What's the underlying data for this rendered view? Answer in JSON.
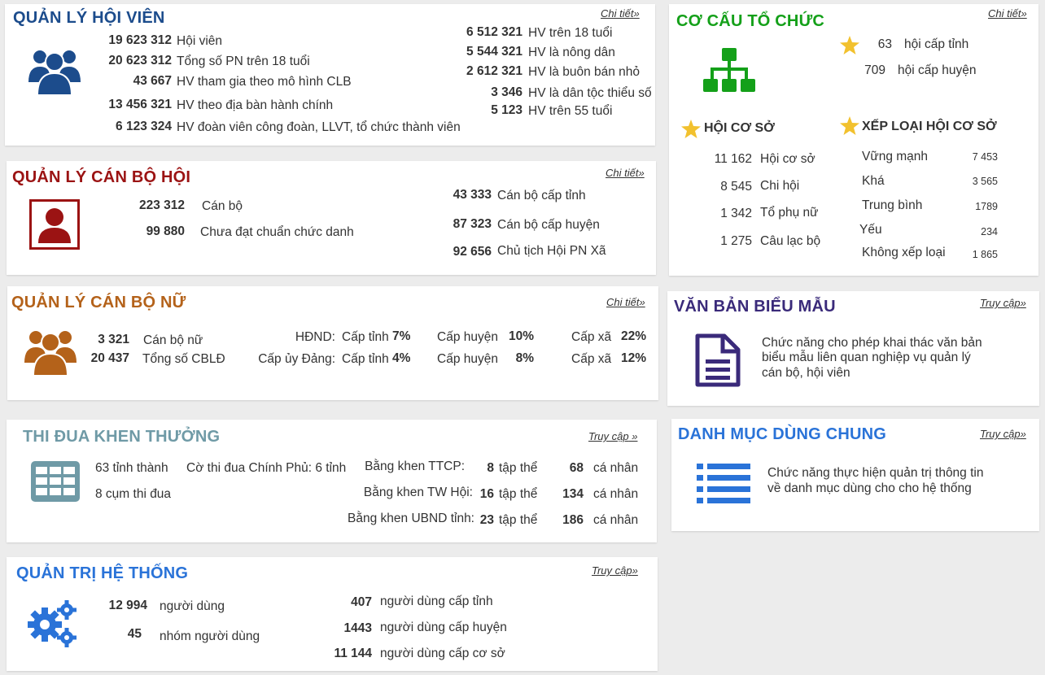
{
  "hoi_vien": {
    "title": "QUẢN LÝ HỘI VIÊN",
    "link": "Chi tiết",
    "left": [
      {
        "value": "19 623 312",
        "label": "Hội viên"
      },
      {
        "value": "20 623 312",
        "label": "Tổng số PN trên 18 tuổi"
      },
      {
        "value": "43 667",
        "label": "HV tham gia theo mô hình CLB"
      },
      {
        "value": "13 456 321",
        "label": "HV theo địa bàn hành chính"
      },
      {
        "value": "6 123 324",
        "label": "HV đoàn viên công đoàn, LLVT, tổ chức thành viên"
      }
    ],
    "right": [
      {
        "value": "6 512 321",
        "label": "HV trên 18 tuổi"
      },
      {
        "value": "5 544 321",
        "label": "HV là nông dân"
      },
      {
        "value": "2 612 321",
        "label": "HV là buôn bán nhỏ"
      },
      {
        "value": "3 346",
        "label": "HV là dân tộc thiểu số"
      },
      {
        "value": "5 123",
        "label": "HV trên 55 tuổi"
      }
    ]
  },
  "can_bo_hoi": {
    "title": "QUẢN LÝ CÁN BỘ HỘI",
    "link": "Chi tiết",
    "left": [
      {
        "value": "223 312",
        "label": "Cán bộ"
      },
      {
        "value": "99 880",
        "label": "Chưa đạt chuẩn chức danh"
      }
    ],
    "right": [
      {
        "value": "43 333",
        "label": "Cán bộ cấp tỉnh"
      },
      {
        "value": "87 323",
        "label": "Cán bộ cấp huyện"
      },
      {
        "value": "92 656",
        "label": "Chủ tịch Hội PN Xã"
      }
    ]
  },
  "can_bo_nu": {
    "title": "QUẢN LÝ CÁN BỘ NỮ",
    "link": "Chi tiết",
    "left": [
      {
        "value": "3 321",
        "label": "Cán bộ nữ"
      },
      {
        "value": "20 437",
        "label": "Tổng số CBLĐ"
      }
    ],
    "rows": [
      {
        "name": "HĐND:",
        "tinh_label": "Cấp tỉnh",
        "tinh_value": "7%",
        "huyen_label": "Cấp huyện",
        "huyen_value": "10%",
        "xa_label": "Cấp xã",
        "xa_value": "22%"
      },
      {
        "name": "Cấp ủy Đảng:",
        "tinh_label": "Cấp tỉnh",
        "tinh_value": "4%",
        "huyen_label": "Cấp huyện",
        "huyen_value": "8%",
        "xa_label": "Cấp xã",
        "xa_value": "12%"
      }
    ]
  },
  "thi_dua": {
    "title": "THI ĐUA KHEN THƯỞNG",
    "link": "Truy cập",
    "left": [
      "63 tỉnh thành",
      "8 cụm thi đua"
    ],
    "co": "Cờ thi đua Chính Phủ: 6 tỉnh",
    "rows": [
      {
        "name": "Bằng khen TTCP:",
        "tap_the": "8",
        "tap_the_label": "tập thể",
        "ca_nhan": "68",
        "ca_nhan_label": "cá nhân"
      },
      {
        "name": "Bằng khen TW Hội:",
        "tap_the": "16",
        "tap_the_label": "tập thể",
        "ca_nhan": "134",
        "ca_nhan_label": "cá nhân"
      },
      {
        "name": "Bằng khen UBND tỉnh:",
        "tap_the": "23",
        "tap_the_label": "tập thể",
        "ca_nhan": "186",
        "ca_nhan_label": "cá nhân"
      }
    ]
  },
  "quan_tri": {
    "title": "QUẢN TRỊ HỆ THỐNG",
    "link": "Truy cập",
    "left": [
      {
        "value": "12 994",
        "label": "người dùng"
      },
      {
        "value": "45",
        "label": "nhóm người dùng"
      }
    ],
    "right": [
      {
        "value": "407",
        "label": "người dùng cấp tỉnh"
      },
      {
        "value": "1443",
        "label": "người dùng cấp huyện"
      },
      {
        "value": "11 144",
        "label": "người dùng cấp cơ sở"
      }
    ]
  },
  "co_cau": {
    "title": "CƠ CẤU TỔ CHỨC",
    "link": "Chi tiết",
    "top": [
      {
        "value": "63",
        "label": "hội cấp tỉnh"
      },
      {
        "value": "709",
        "label": "hội cấp huyện"
      }
    ],
    "hoi_co_so_title": "HỘI CƠ SỞ",
    "hoi_co_so": [
      {
        "value": "11 162",
        "label": "Hội cơ sở"
      },
      {
        "value": "8 545",
        "label": "Chi hội"
      },
      {
        "value": "1 342",
        "label": "Tổ phụ nữ"
      },
      {
        "value": "1 275",
        "label": "Câu lạc bộ"
      }
    ],
    "xep_loai_title": "XẾP LOẠI HỘI CƠ SỞ",
    "xep_loai": [
      {
        "label": "Vững mạnh",
        "value": "7 453"
      },
      {
        "label": "Khá",
        "value": "3 565"
      },
      {
        "label": "Trung bình",
        "value": "1789"
      },
      {
        "label": "Yếu",
        "value": "234"
      },
      {
        "label": "Không xếp loại",
        "value": "1 865"
      }
    ]
  },
  "van_ban": {
    "title": "VĂN BẢN BIỂU MẪU",
    "link": "Truy cập",
    "desc": [
      "Chức năng cho phép khai thác văn bản",
      "biểu mẫu liên quan nghiệp vụ quản lý",
      "cán bộ, hội viên"
    ]
  },
  "danh_muc": {
    "title": "DANH MỤC DÙNG CHUNG",
    "link": "Truy cập",
    "desc": [
      "Chức năng thực hiện quản trị thông tin",
      "về danh mục dùng cho cho hệ thống"
    ]
  },
  "icons": {
    "hoi_vien": "users-group-icon",
    "can_bo_hoi": "user-card-icon",
    "can_bo_nu": "users-group-icon",
    "thi_dua": "table-grid-icon",
    "quan_tri": "gears-icon",
    "co_cau": "org-chart-icon",
    "van_ban": "document-icon",
    "danh_muc": "list-icon",
    "star": "star-icon"
  },
  "colors": {
    "hoi_vien": "#1c4c8c",
    "can_bo_hoi": "#9b1313",
    "can_bo_nu": "#b4621a",
    "thi_dua": "#6f9aa6",
    "quan_tri": "#2a73d8",
    "co_cau": "#14a019",
    "van_ban": "#3a2a7a",
    "danh_muc": "#2a73d8",
    "star": "#f2c12e"
  }
}
